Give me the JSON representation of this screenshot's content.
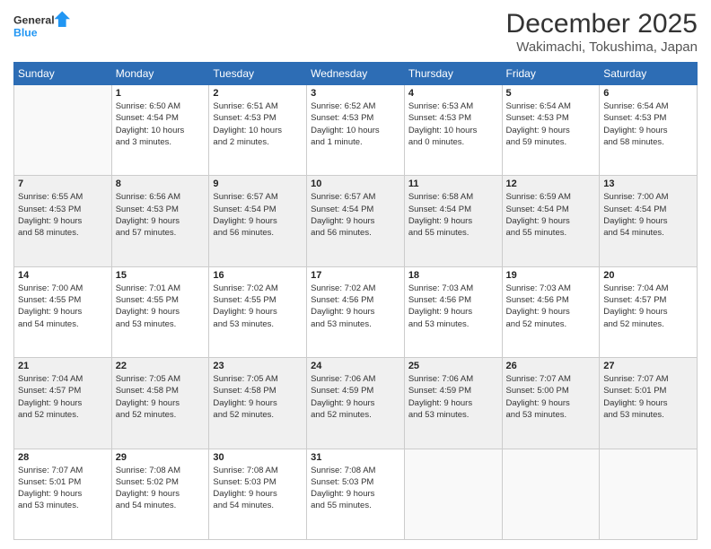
{
  "logo": {
    "line1": "General",
    "line2": "Blue"
  },
  "title": "December 2025",
  "subtitle": "Wakimachi, Tokushima, Japan",
  "days_of_week": [
    "Sunday",
    "Monday",
    "Tuesday",
    "Wednesday",
    "Thursday",
    "Friday",
    "Saturday"
  ],
  "weeks": [
    [
      {
        "num": "",
        "info": ""
      },
      {
        "num": "1",
        "info": "Sunrise: 6:50 AM\nSunset: 4:54 PM\nDaylight: 10 hours\nand 3 minutes."
      },
      {
        "num": "2",
        "info": "Sunrise: 6:51 AM\nSunset: 4:53 PM\nDaylight: 10 hours\nand 2 minutes."
      },
      {
        "num": "3",
        "info": "Sunrise: 6:52 AM\nSunset: 4:53 PM\nDaylight: 10 hours\nand 1 minute."
      },
      {
        "num": "4",
        "info": "Sunrise: 6:53 AM\nSunset: 4:53 PM\nDaylight: 10 hours\nand 0 minutes."
      },
      {
        "num": "5",
        "info": "Sunrise: 6:54 AM\nSunset: 4:53 PM\nDaylight: 9 hours\nand 59 minutes."
      },
      {
        "num": "6",
        "info": "Sunrise: 6:54 AM\nSunset: 4:53 PM\nDaylight: 9 hours\nand 58 minutes."
      }
    ],
    [
      {
        "num": "7",
        "info": "Sunrise: 6:55 AM\nSunset: 4:53 PM\nDaylight: 9 hours\nand 58 minutes."
      },
      {
        "num": "8",
        "info": "Sunrise: 6:56 AM\nSunset: 4:53 PM\nDaylight: 9 hours\nand 57 minutes."
      },
      {
        "num": "9",
        "info": "Sunrise: 6:57 AM\nSunset: 4:54 PM\nDaylight: 9 hours\nand 56 minutes."
      },
      {
        "num": "10",
        "info": "Sunrise: 6:57 AM\nSunset: 4:54 PM\nDaylight: 9 hours\nand 56 minutes."
      },
      {
        "num": "11",
        "info": "Sunrise: 6:58 AM\nSunset: 4:54 PM\nDaylight: 9 hours\nand 55 minutes."
      },
      {
        "num": "12",
        "info": "Sunrise: 6:59 AM\nSunset: 4:54 PM\nDaylight: 9 hours\nand 55 minutes."
      },
      {
        "num": "13",
        "info": "Sunrise: 7:00 AM\nSunset: 4:54 PM\nDaylight: 9 hours\nand 54 minutes."
      }
    ],
    [
      {
        "num": "14",
        "info": "Sunrise: 7:00 AM\nSunset: 4:55 PM\nDaylight: 9 hours\nand 54 minutes."
      },
      {
        "num": "15",
        "info": "Sunrise: 7:01 AM\nSunset: 4:55 PM\nDaylight: 9 hours\nand 53 minutes."
      },
      {
        "num": "16",
        "info": "Sunrise: 7:02 AM\nSunset: 4:55 PM\nDaylight: 9 hours\nand 53 minutes."
      },
      {
        "num": "17",
        "info": "Sunrise: 7:02 AM\nSunset: 4:56 PM\nDaylight: 9 hours\nand 53 minutes."
      },
      {
        "num": "18",
        "info": "Sunrise: 7:03 AM\nSunset: 4:56 PM\nDaylight: 9 hours\nand 53 minutes."
      },
      {
        "num": "19",
        "info": "Sunrise: 7:03 AM\nSunset: 4:56 PM\nDaylight: 9 hours\nand 52 minutes."
      },
      {
        "num": "20",
        "info": "Sunrise: 7:04 AM\nSunset: 4:57 PM\nDaylight: 9 hours\nand 52 minutes."
      }
    ],
    [
      {
        "num": "21",
        "info": "Sunrise: 7:04 AM\nSunset: 4:57 PM\nDaylight: 9 hours\nand 52 minutes."
      },
      {
        "num": "22",
        "info": "Sunrise: 7:05 AM\nSunset: 4:58 PM\nDaylight: 9 hours\nand 52 minutes."
      },
      {
        "num": "23",
        "info": "Sunrise: 7:05 AM\nSunset: 4:58 PM\nDaylight: 9 hours\nand 52 minutes."
      },
      {
        "num": "24",
        "info": "Sunrise: 7:06 AM\nSunset: 4:59 PM\nDaylight: 9 hours\nand 52 minutes."
      },
      {
        "num": "25",
        "info": "Sunrise: 7:06 AM\nSunset: 4:59 PM\nDaylight: 9 hours\nand 53 minutes."
      },
      {
        "num": "26",
        "info": "Sunrise: 7:07 AM\nSunset: 5:00 PM\nDaylight: 9 hours\nand 53 minutes."
      },
      {
        "num": "27",
        "info": "Sunrise: 7:07 AM\nSunset: 5:01 PM\nDaylight: 9 hours\nand 53 minutes."
      }
    ],
    [
      {
        "num": "28",
        "info": "Sunrise: 7:07 AM\nSunset: 5:01 PM\nDaylight: 9 hours\nand 53 minutes."
      },
      {
        "num": "29",
        "info": "Sunrise: 7:08 AM\nSunset: 5:02 PM\nDaylight: 9 hours\nand 54 minutes."
      },
      {
        "num": "30",
        "info": "Sunrise: 7:08 AM\nSunset: 5:03 PM\nDaylight: 9 hours\nand 54 minutes."
      },
      {
        "num": "31",
        "info": "Sunrise: 7:08 AM\nSunset: 5:03 PM\nDaylight: 9 hours\nand 55 minutes."
      },
      {
        "num": "",
        "info": ""
      },
      {
        "num": "",
        "info": ""
      },
      {
        "num": "",
        "info": ""
      }
    ]
  ]
}
